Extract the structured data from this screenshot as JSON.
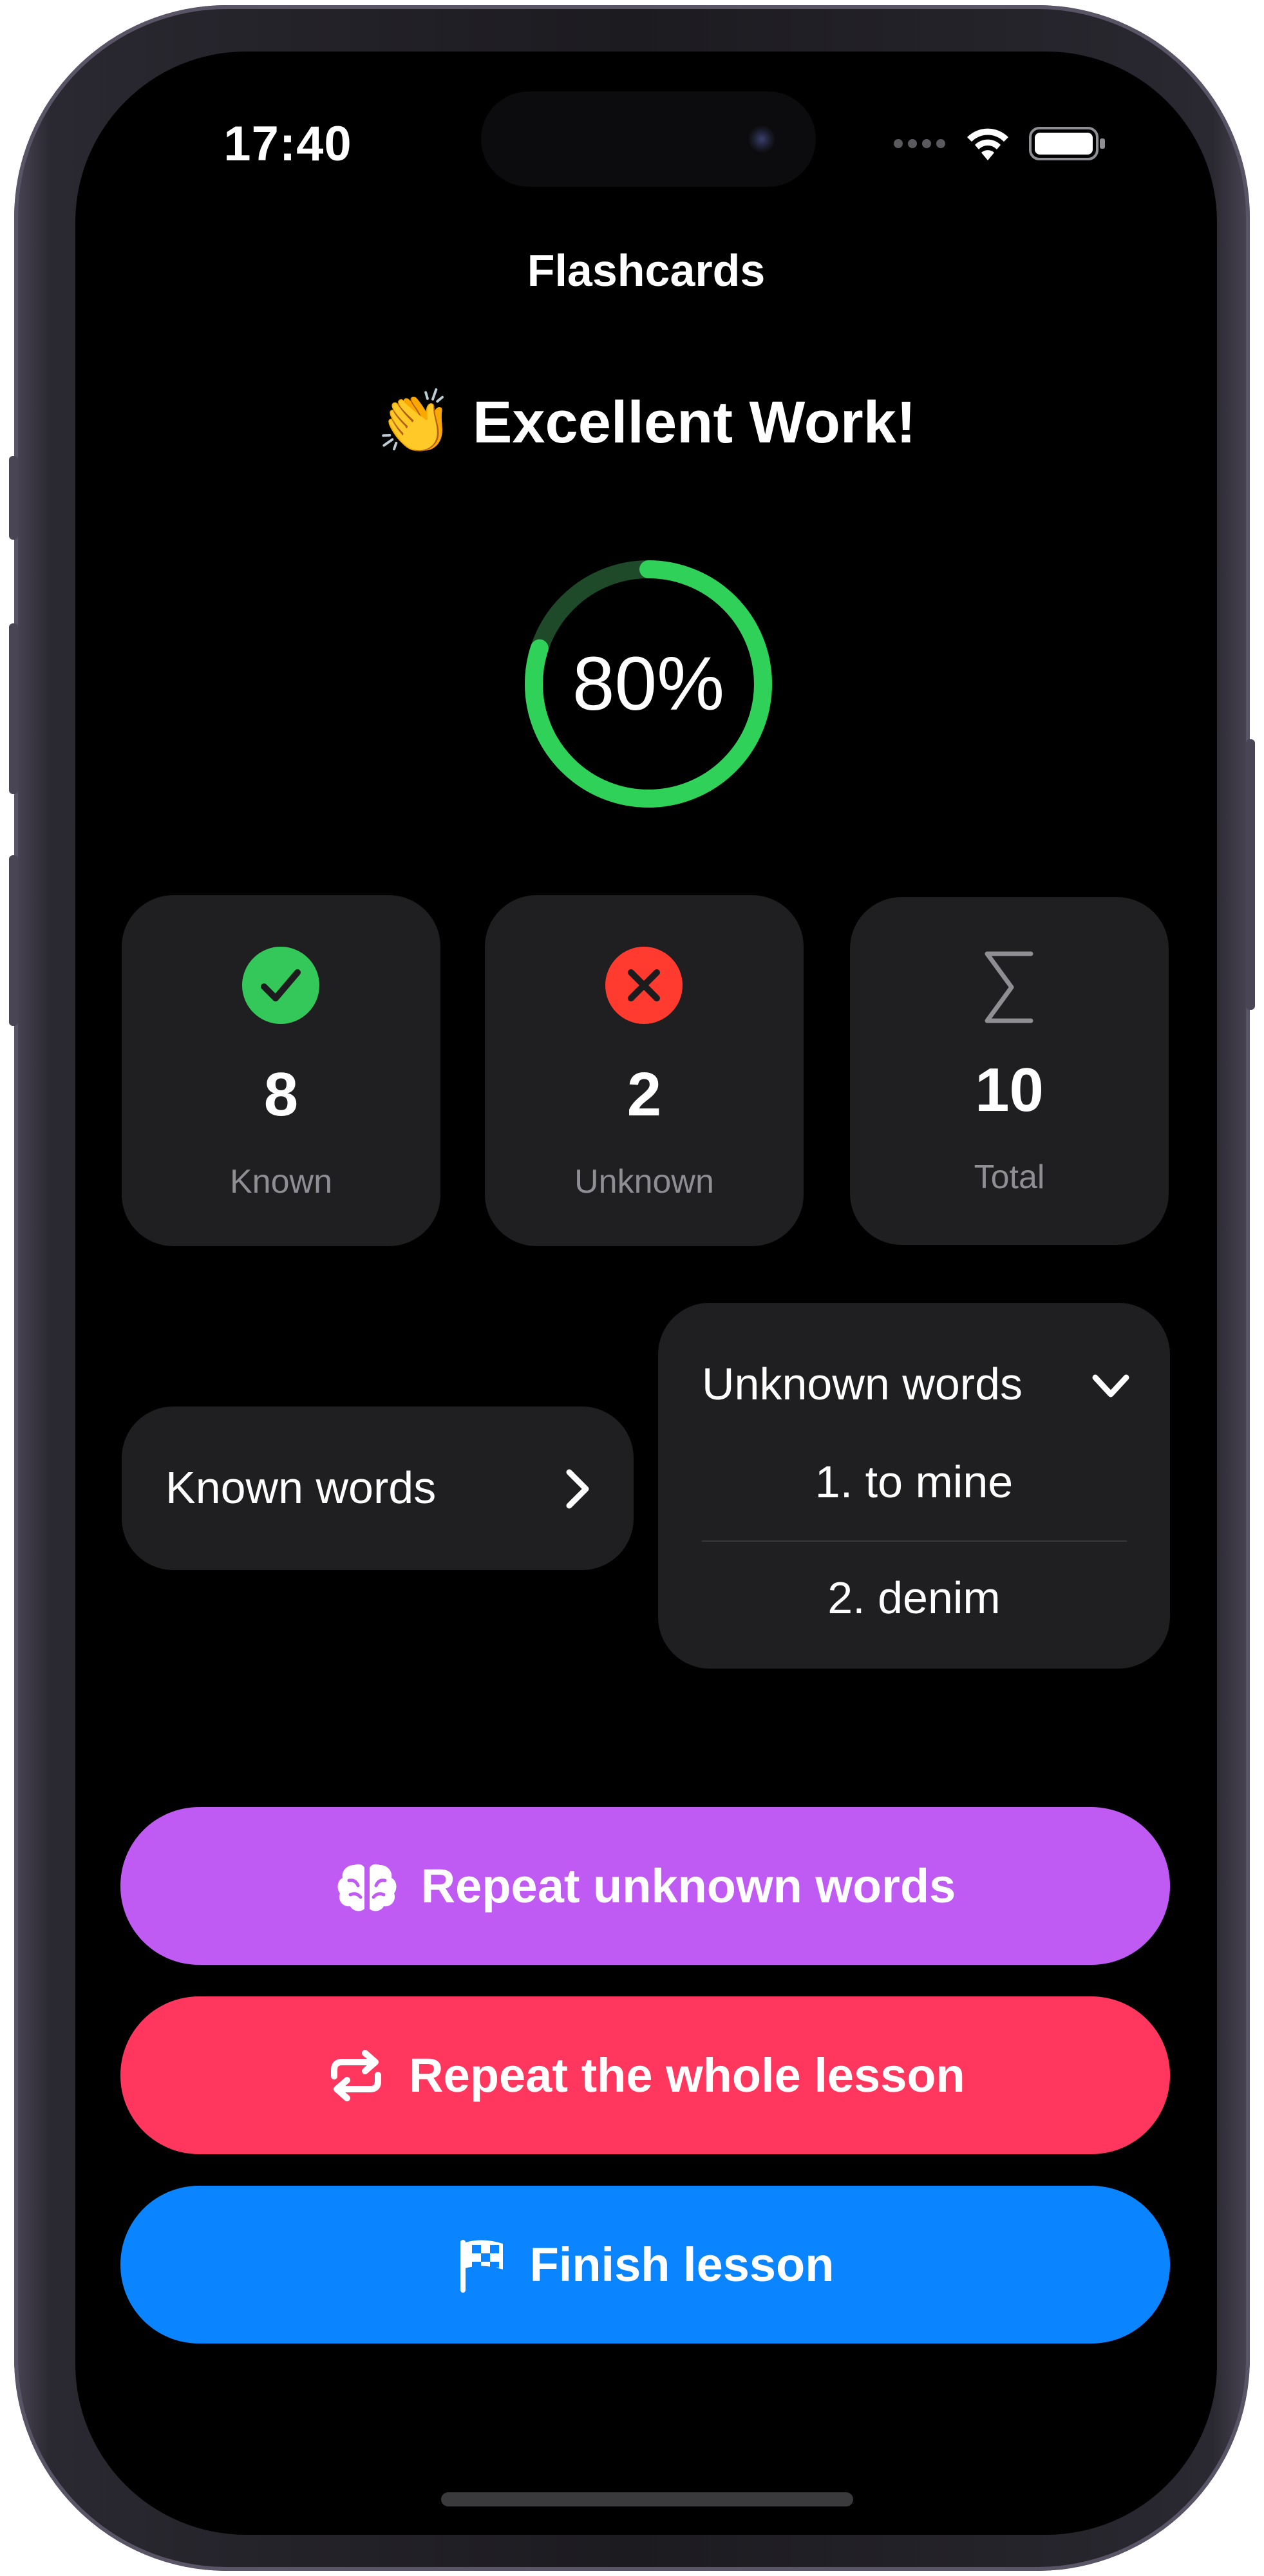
{
  "status_bar": {
    "time": "17:40",
    "icons": [
      "cellular-icon",
      "wifi-icon",
      "battery-icon"
    ]
  },
  "nav": {
    "title": "Flashcards"
  },
  "result": {
    "emoji": "👏",
    "headline": "Excellent Work!",
    "score_percent": 80,
    "score_label": "80%"
  },
  "stats": [
    {
      "icon": "checkmark-circle-icon",
      "value": "8",
      "label": "Known",
      "color": "#34c759"
    },
    {
      "icon": "x-circle-icon",
      "value": "2",
      "label": "Unknown",
      "color": "#ff3b30"
    },
    {
      "icon": "sigma-icon",
      "value": "10",
      "label": "Total",
      "color": "#8e8e93"
    }
  ],
  "known_words": {
    "label": "Known words"
  },
  "unknown_words": {
    "label": "Unknown words",
    "items": [
      "1. to mine",
      "2. denim"
    ]
  },
  "actions": {
    "repeat_unknown": {
      "label": "Repeat unknown words",
      "icon": "brain-icon",
      "color": "#bf5af2"
    },
    "repeat_lesson": {
      "label": "Repeat the whole lesson",
      "icon": "repeat-icon",
      "color": "#ff375f"
    },
    "finish": {
      "label": "Finish lesson",
      "icon": "checkered-flag-icon",
      "color": "#0a84ff"
    }
  },
  "colors": {
    "progress": "#30d158",
    "progress_track": "#1f4a2a",
    "card": "#1f1f21",
    "background": "#000000"
  }
}
